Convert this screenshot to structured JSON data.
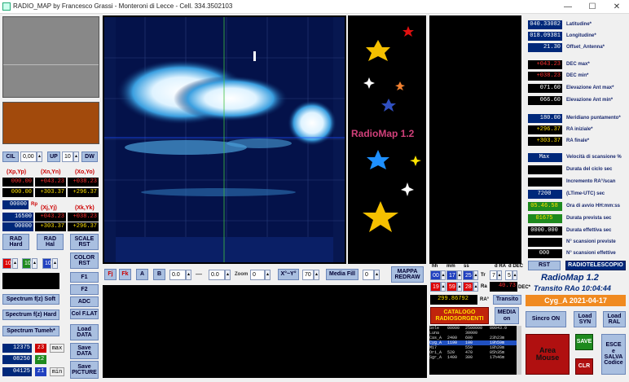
{
  "window": {
    "title": "RADIO_MAP by Francesco Grassi - Monteroni di Lecce - Cell. 334.3502103",
    "min": "—",
    "max": "☐",
    "close": "✕"
  },
  "left": {
    "cil_label": "CIL",
    "cil_value": "0,00",
    "up_label": "UP",
    "up_value": "10",
    "dw_label": "DW",
    "hdr_xpyp": "(Xp,Yp)",
    "hdr_xnyn": "(Xn,Yn)",
    "hdr_xoyo": "(Xo,Yo)",
    "r1": [
      "000.00",
      "+043.23",
      "+038.23"
    ],
    "r2": [
      "000.00",
      "+303.37",
      "+296.37"
    ],
    "mid_r1": "00000",
    "mid_label": "Rp",
    "hdr_xjyj": "(Xj,Yj)",
    "hdr_xkyk": "(Xk,Yk)",
    "r3": [
      "16500",
      "+043.23",
      "+038.23"
    ],
    "r4": [
      "00000",
      "+303.37",
      "+296.37"
    ],
    "rad_hard": "RAD\nHard",
    "rad_hal": "RAD\nHal",
    "scale_rst": "SCALE\nRST",
    "color_rst": "COLOR\nRST",
    "spin_red": "10",
    "spin_green": "10",
    "spin_blue": "10",
    "f1": "F1",
    "f2": "F2",
    "adc": "ADC",
    "col_flat": "Col F.LAT",
    "spec_soft": "Spectrum f(z) Soft",
    "spec_hard": "Spectrum f(z) Hard",
    "spec_tumeh": "Spectrum Tumeh*",
    "load_data": "Load\nDATA",
    "save_data": "Save\nDATA",
    "save_picture": "Save\nPICTURE",
    "v1": "12375",
    "v2": "08250",
    "v3": "04125",
    "z3": "z3",
    "z2": "z2",
    "z1": "z1",
    "max": "max",
    "min": "min"
  },
  "toolbar": {
    "fj": "Fj",
    "fk": "Fk",
    "a": "A",
    "b": "B",
    "val1": "0.0",
    "dash": "—",
    "val2": "0.0",
    "zoom_label": "Zoom",
    "zoom_val": "0",
    "xy": "X°~Y°",
    "val70": "70",
    "media_fill": "Media Fill",
    "val0": "0",
    "mappa_redraw": "MAPPA\nREDRAW"
  },
  "center": {
    "radiomap": "RadioMap 1.2"
  },
  "ctrl": {
    "hh": "hh",
    "mm": "mm",
    "ss": "ss",
    "d_ra": "d RA",
    "d_dec": "d DEC",
    "h1": "00",
    "m1": "17",
    "s1": "25",
    "tr": "Tr",
    "tr_val": "7",
    "dra_val": "5",
    "h2": "19",
    "m2": "59",
    "s2": "28",
    "ra_label": "Ra",
    "ra_val": "40.73",
    "dec_star": "DEC*",
    "transito": "Transito",
    "ra_display": "299.86792",
    "ra_star": "RA°",
    "catalogo": "CATALOGO\nRADIOSORGENTI",
    "media_on": "MEDIA\non"
  },
  "catalog": [
    [
      "Sole",
      "00000",
      "2500000",
      "00043.0"
    ],
    [
      "Luna",
      "",
      "30000",
      ""
    ],
    [
      "Cas_A",
      "2400",
      "600",
      "23h23m"
    ],
    [
      "Cyg_A",
      "1190",
      "100",
      "19h59m"
    ],
    [
      "M17",
      "",
      "550",
      "18h20m"
    ],
    [
      "Ori_A",
      "520",
      "470",
      "05h35m"
    ],
    [
      "Sgr_A",
      "1400",
      "300",
      "17h46m"
    ]
  ],
  "right": {
    "latitudine_v": "040.33082",
    "latitudine_l": "Latitudine*",
    "longitudine_v": "018.09381",
    "longitudine_l": "Longitudine*",
    "offset_v": "21.30",
    "offset_l": "Offset_Antenna*",
    "decmax_v": "+043.23",
    "decmax_l": "DEC max*",
    "decmin_v": "+038.23",
    "decmin_l": "DEC min*",
    "elevmax_v": "071.60",
    "elevmax_l": "Elevazione Ant max*",
    "elevmin_v": "066.60",
    "elevmin_l": "Elevazione Ant min*",
    "meridiano_v": "180.00",
    "meridiano_l": "Meridiano puntamento*",
    "rain_v": "+296.37",
    "rain_l": "RA iniziale*",
    "rafin_v": "+303.37",
    "rafin_l": "RA finale*",
    "max_btn": "Max",
    "vel_l": "Velocità di scansione %",
    "durata_ciclo_l": "Durata del ciclo sec",
    "incremento_l": "Incremento RA°/scan",
    "ltime_v": "7200",
    "ltime_l": "(LTime-UTC) sec",
    "avvio_v": "05.46.58",
    "avvio_l": "Ora di avvio HH:mm:ss",
    "prev_v": "01675",
    "prev_l": "Durata prevista sec",
    "eff_v": "0000.000",
    "eff_l": "Durata effettiva sec",
    "nprev_l": "N° scansioni previste",
    "neff_v": "000",
    "neff_l": "N° scansioni effettive",
    "rst": "RST",
    "radiotelescopio": "RADIOTELESCOPIO",
    "radiomap": "RadioMap 1.2",
    "transito": "Transito RAo 10:04:44",
    "source_date": "Cyg_A 2021-04-17",
    "sincro_on": "Sincro ON",
    "load_syn": "Load\nSYN",
    "load_ral": "Load\nRAL",
    "area_mouse": "Area\nMouse",
    "save": "SAVE",
    "clr": "CLR",
    "esce": "ESCE\ne\nSALVA\nCodice"
  }
}
